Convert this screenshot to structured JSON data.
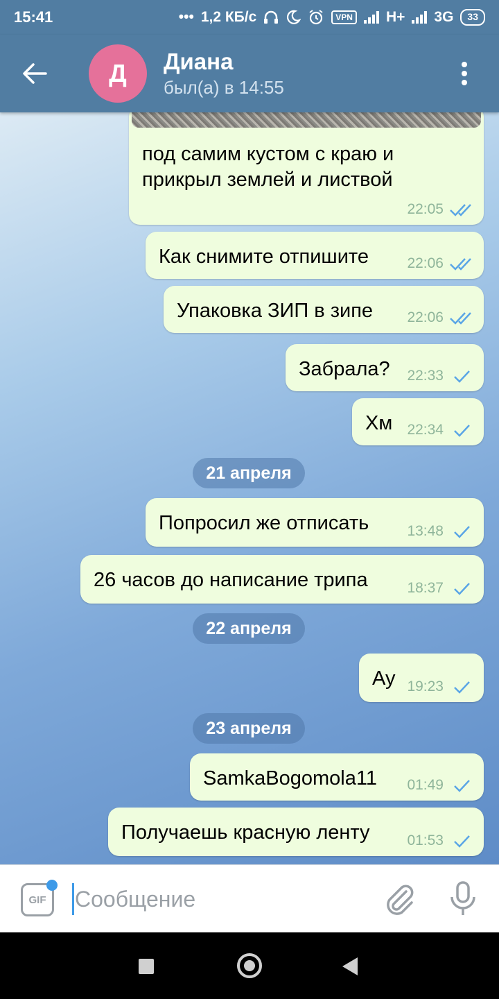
{
  "status_bar": {
    "time": "15:41",
    "dots": "•••",
    "speed": "1,2 КБ/с",
    "vpn": "VPN",
    "net1": "H+",
    "net2": "3G",
    "battery": "33",
    "icons": [
      "headphones-icon",
      "moon-icon",
      "alarm-icon",
      "vpn-icon",
      "signal-icon",
      "battery-icon"
    ]
  },
  "header": {
    "avatar_letter": "Д",
    "avatar_color": "#e5719a",
    "contact_name": "Диана",
    "last_seen": "был(а) в 14:55",
    "bar_color": "#517da2"
  },
  "messages": [
    {
      "text_line1": "под самим кустом с краю и",
      "text_line2": "прикрыл землей и листвой",
      "time": "22:05",
      "status": "read"
    },
    {
      "text": "Как снимите отпишите",
      "time": "22:06",
      "status": "read"
    },
    {
      "text": "Упаковка ЗИП в зипе",
      "time": "22:06",
      "status": "read"
    },
    {
      "text": "Забрала?",
      "time": "22:33",
      "status": "sent"
    },
    {
      "text": "Хм",
      "time": "22:34",
      "status": "sent"
    },
    {
      "text": "Попросил же отписать",
      "time": "13:48",
      "status": "sent"
    },
    {
      "text": "26 часов до написание трипа",
      "time": "18:37",
      "status": "sent"
    },
    {
      "text": "Ау",
      "time": "19:23",
      "status": "sent"
    },
    {
      "text": "SamkaBogomola11",
      "time": "01:49",
      "status": "sent"
    },
    {
      "text": "Получаешь красную ленту",
      "time": "01:53",
      "status": "sent"
    }
  ],
  "dates": [
    "21 апреля",
    "22 апреля",
    "23 апреля"
  ],
  "composer": {
    "gif_label": "GIF",
    "placeholder": "Сообщение",
    "value": ""
  },
  "colors": {
    "bubble": "#effdde",
    "tick": "#5aa5e6",
    "accent": "#3d9ae8"
  }
}
